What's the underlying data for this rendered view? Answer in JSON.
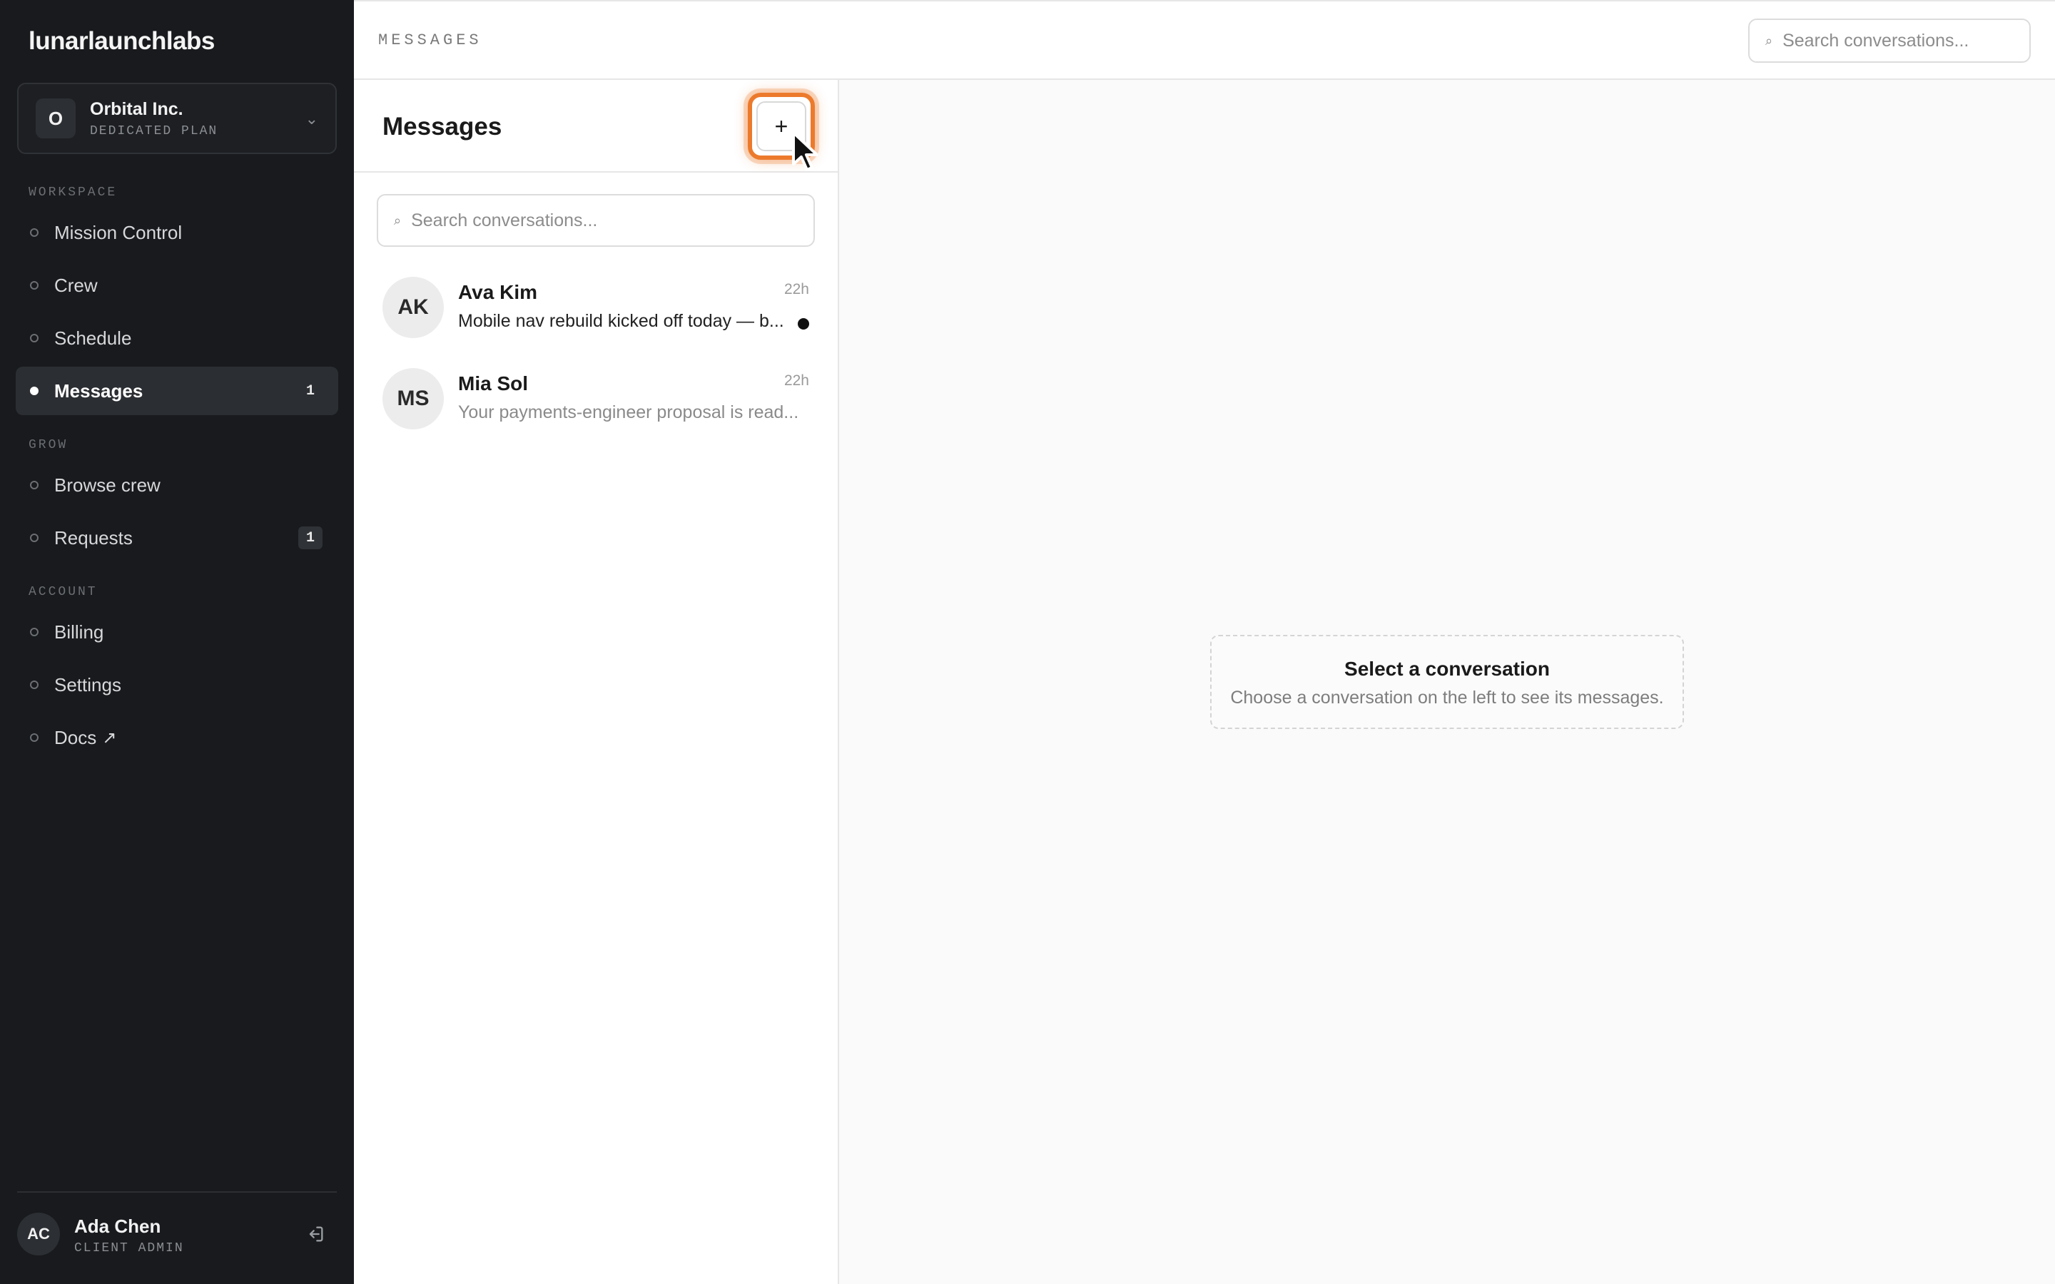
{
  "brand": {
    "name": "lunarlaunchlabs"
  },
  "org": {
    "avatar": "O",
    "name": "Orbital Inc.",
    "plan": "DEDICATED PLAN"
  },
  "nav": {
    "sections": {
      "workspace": "WORKSPACE",
      "grow": "GROW",
      "account": "ACCOUNT"
    },
    "items": [
      {
        "label": "Mission Control"
      },
      {
        "label": "Crew"
      },
      {
        "label": "Schedule"
      },
      {
        "label": "Messages",
        "badge": "1",
        "active": true
      },
      {
        "label": "Browse crew"
      },
      {
        "label": "Requests",
        "badge": "1"
      },
      {
        "label": "Billing"
      },
      {
        "label": "Settings"
      },
      {
        "label": "Docs",
        "icon": "external-link-icon"
      }
    ]
  },
  "user": {
    "initials": "AC",
    "name": "Ada Chen",
    "role": "CLIENT ADMIN"
  },
  "topbar": {
    "title": "MESSAGES",
    "search_placeholder": "Search conversations..."
  },
  "conversations": {
    "title": "Messages",
    "new_button_label": "+",
    "search_placeholder": "Search conversations...",
    "items": [
      {
        "initials": "AK",
        "name": "Ava Kim",
        "time": "22h",
        "preview": "Mobile nav rebuild kicked off today — b...",
        "unread": true
      },
      {
        "initials": "MS",
        "name": "Mia Sol",
        "time": "22h",
        "preview": "Your payments-engineer proposal is read...",
        "unread": false
      }
    ]
  },
  "empty_state": {
    "title": "Select a conversation",
    "description": "Choose a conversation on the left to see its messages."
  },
  "colors": {
    "sidebar_bg": "#181a1d",
    "accent_highlight": "#ec7a2c",
    "unread_dot": "#111111"
  }
}
